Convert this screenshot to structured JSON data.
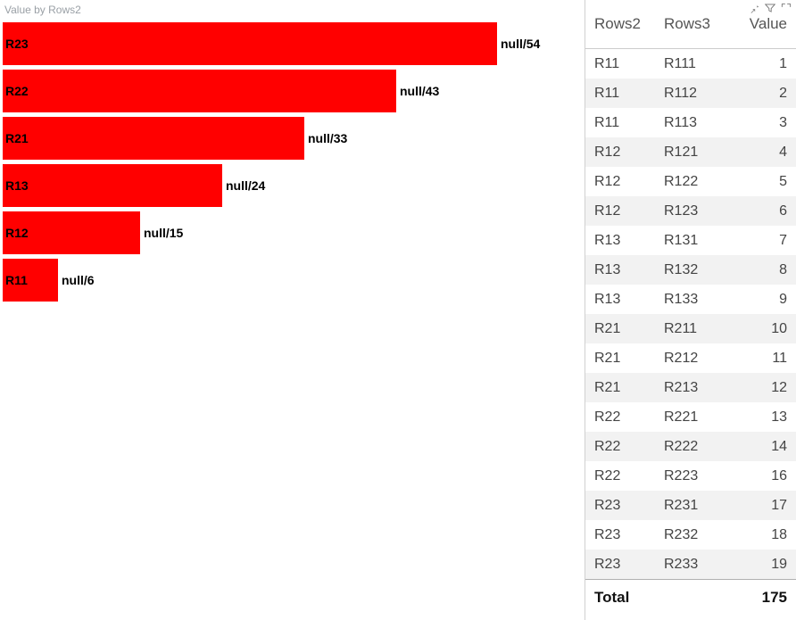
{
  "chart_data": {
    "type": "bar",
    "orientation": "horizontal",
    "title": "Value by Rows2",
    "xlabel": "",
    "ylabel": "",
    "xlim": [
      0,
      60
    ],
    "categories": [
      "R23",
      "R22",
      "R21",
      "R13",
      "R12",
      "R11"
    ],
    "values": [
      54,
      43,
      33,
      24,
      15,
      6
    ],
    "data_labels": [
      "null/54",
      "null/43",
      "null/33",
      "null/24",
      "null/15",
      "null/6"
    ],
    "bar_color": "#ff0000"
  },
  "table": {
    "headers": {
      "col1": "Rows2",
      "col2": "Rows3",
      "col3": "Value"
    },
    "rows": [
      {
        "r2": "R11",
        "r3": "R111",
        "v": 1
      },
      {
        "r2": "R11",
        "r3": "R112",
        "v": 2
      },
      {
        "r2": "R11",
        "r3": "R113",
        "v": 3
      },
      {
        "r2": "R12",
        "r3": "R121",
        "v": 4
      },
      {
        "r2": "R12",
        "r3": "R122",
        "v": 5
      },
      {
        "r2": "R12",
        "r3": "R123",
        "v": 6
      },
      {
        "r2": "R13",
        "r3": "R131",
        "v": 7
      },
      {
        "r2": "R13",
        "r3": "R132",
        "v": 8
      },
      {
        "r2": "R13",
        "r3": "R133",
        "v": 9
      },
      {
        "r2": "R21",
        "r3": "R211",
        "v": 10
      },
      {
        "r2": "R21",
        "r3": "R212",
        "v": 11
      },
      {
        "r2": "R21",
        "r3": "R213",
        "v": 12
      },
      {
        "r2": "R22",
        "r3": "R221",
        "v": 13
      },
      {
        "r2": "R22",
        "r3": "R222",
        "v": 14
      },
      {
        "r2": "R22",
        "r3": "R223",
        "v": 16
      },
      {
        "r2": "R23",
        "r3": "R231",
        "v": 17
      },
      {
        "r2": "R23",
        "r3": "R232",
        "v": 18
      },
      {
        "r2": "R23",
        "r3": "R233",
        "v": 19
      }
    ],
    "total_label": "Total",
    "total_value": 175
  },
  "icons": {
    "pin": "pin-icon",
    "filter": "filter-icon",
    "focus": "focus-icon"
  }
}
